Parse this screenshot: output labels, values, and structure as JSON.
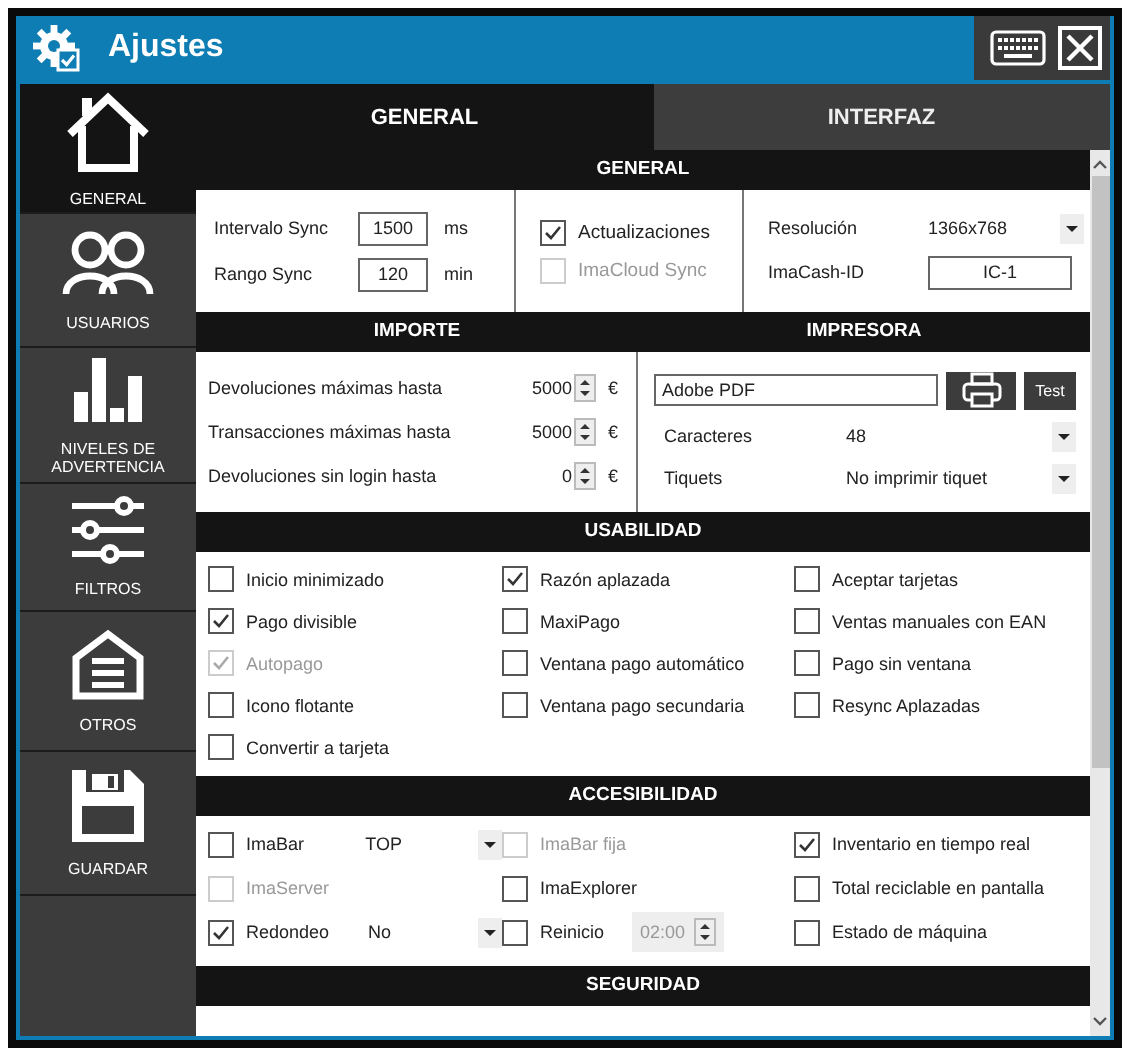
{
  "window": {
    "title": "Ajustes"
  },
  "sidebar": {
    "items": [
      {
        "label": "GENERAL",
        "selected": true
      },
      {
        "label": "USUARIOS",
        "selected": false
      },
      {
        "label": "NIVELES DE ADVERTENCIA",
        "selected": false
      },
      {
        "label": "FILTROS",
        "selected": false
      },
      {
        "label": "OTROS",
        "selected": false
      },
      {
        "label": "GUARDAR",
        "selected": false
      }
    ]
  },
  "tabs": [
    {
      "label": "GENERAL",
      "selected": true
    },
    {
      "label": "INTERFAZ",
      "selected": false
    }
  ],
  "general": {
    "title": "GENERAL",
    "fields": [
      {
        "label": "Intervalo Sync",
        "value": "1500",
        "unit": "ms"
      },
      {
        "label": "Rango Sync",
        "value": "120",
        "unit": "min"
      }
    ],
    "checks": [
      {
        "label": "Actualizaciones",
        "checked": true,
        "disabled": false
      },
      {
        "label": "ImaCloud Sync",
        "checked": false,
        "disabled": true
      }
    ],
    "resolution": {
      "label": "Resolución",
      "value": "1366x768"
    },
    "id": {
      "label": "ImaCash-ID",
      "value": "IC-1"
    }
  },
  "importe": {
    "title": "IMPORTE",
    "rows": [
      {
        "label": "Devoluciones máximas hasta",
        "value": "5000",
        "unit": "€"
      },
      {
        "label": "Transacciones máximas hasta",
        "value": "5000",
        "unit": "€"
      },
      {
        "label": "Devoluciones sin login hasta",
        "value": "0",
        "unit": "€"
      }
    ]
  },
  "impresora": {
    "title": "IMPRESORA",
    "printer": "Adobe PDF",
    "test_button": "Test",
    "selects": [
      {
        "label": "Caracteres",
        "value": "48"
      },
      {
        "label": "Tiquets",
        "value": "No imprimir tiquet"
      }
    ]
  },
  "usabilidad": {
    "title": "USABILIDAD",
    "items": [
      {
        "label": "Inicio minimizado",
        "checked": false,
        "disabled": false
      },
      {
        "label": "Razón aplazada",
        "checked": true,
        "disabled": false
      },
      {
        "label": "Aceptar tarjetas",
        "checked": false,
        "disabled": false
      },
      {
        "label": "Pago divisible",
        "checked": true,
        "disabled": false
      },
      {
        "label": "MaxiPago",
        "checked": false,
        "disabled": false
      },
      {
        "label": "Ventas manuales con EAN",
        "checked": false,
        "disabled": false
      },
      {
        "label": "Autopago",
        "checked": true,
        "disabled": true
      },
      {
        "label": "Ventana pago automático",
        "checked": false,
        "disabled": false
      },
      {
        "label": "Pago sin ventana",
        "checked": false,
        "disabled": false
      },
      {
        "label": "Icono flotante",
        "checked": false,
        "disabled": false
      },
      {
        "label": "Ventana pago secundaria",
        "checked": false,
        "disabled": false
      },
      {
        "label": "Resync Aplazadas",
        "checked": false,
        "disabled": false
      },
      {
        "label": "Convertir a tarjeta",
        "checked": false,
        "disabled": false
      }
    ]
  },
  "accesibilidad": {
    "title": "ACCESIBILIDAD",
    "items": [
      {
        "label": "ImaBar",
        "checked": false,
        "disabled": false,
        "extra": {
          "kind": "select",
          "value": "TOP"
        }
      },
      {
        "label": "ImaBar fija",
        "checked": false,
        "disabled": true
      },
      {
        "label": "Inventario en tiempo real",
        "checked": true,
        "disabled": false
      },
      {
        "label": "ImaServer",
        "checked": false,
        "disabled": true
      },
      {
        "label": "ImaExplorer",
        "checked": false,
        "disabled": false
      },
      {
        "label": "Total reciclable en pantalla",
        "checked": false,
        "disabled": false
      },
      {
        "label": "Redondeo",
        "checked": true,
        "disabled": false,
        "extra": {
          "kind": "select",
          "value": "No"
        }
      },
      {
        "label": "Reinicio",
        "checked": false,
        "disabled": false,
        "extra": {
          "kind": "time",
          "value": "02:00",
          "disabled": true
        }
      },
      {
        "label": "Estado de máquina",
        "checked": false,
        "disabled": false
      }
    ]
  },
  "seguridad": {
    "title": "SEGURIDAD"
  }
}
